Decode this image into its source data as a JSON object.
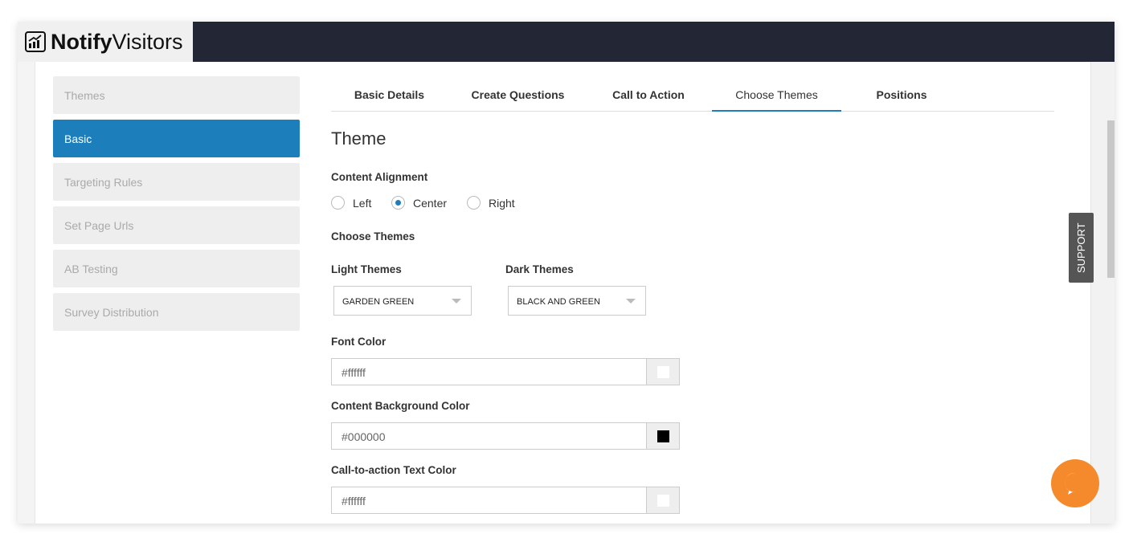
{
  "brand": {
    "name_bold": "Notify",
    "name_rest": "Visitors"
  },
  "sidebar": {
    "items": [
      {
        "label": "Themes"
      },
      {
        "label": "Basic"
      },
      {
        "label": "Targeting Rules"
      },
      {
        "label": "Set Page Urls"
      },
      {
        "label": "AB Testing"
      },
      {
        "label": "Survey Distribution"
      }
    ]
  },
  "tabs": [
    {
      "label": "Basic Details"
    },
    {
      "label": "Create Questions"
    },
    {
      "label": "Call to Action"
    },
    {
      "label": "Choose Themes"
    },
    {
      "label": "Positions"
    }
  ],
  "main": {
    "title": "Theme",
    "content_alignment": "Content Alignment",
    "alignment_options": [
      {
        "label": "Left"
      },
      {
        "label": "Center"
      },
      {
        "label": "Right"
      }
    ],
    "alignment_selected": "Center",
    "choose_themes": "Choose Themes",
    "light_label": "Light Themes",
    "light_value": "GARDEN GREEN",
    "dark_label": "Dark Themes",
    "dark_value": "BLACK AND GREEN",
    "font_color_label": "Font Color",
    "font_color": "#ffffff",
    "content_bg_label": "Content Background Color",
    "content_bg": "#000000",
    "cta_text_label": "Call-to-action Text Color",
    "cta_text": "#ffffff"
  },
  "support": "SUPPORT",
  "colors": {
    "accent": "#1c7fbc",
    "header": "#232635",
    "chat": "#f58a2d"
  }
}
